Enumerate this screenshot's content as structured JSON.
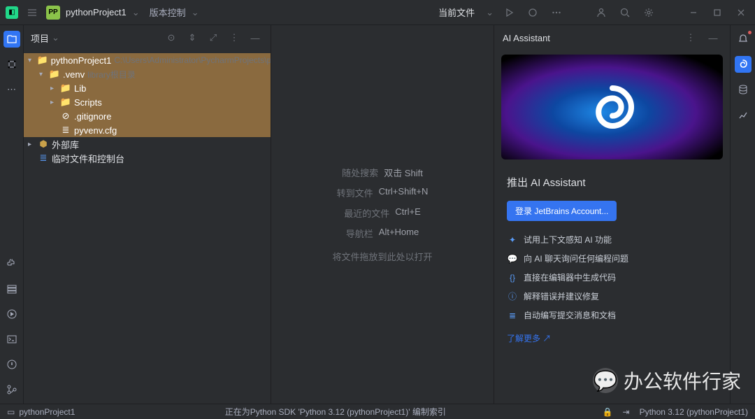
{
  "titlebar": {
    "project_name": "pythonProject1",
    "vcs_label": "版本控制",
    "current_file": "当前文件"
  },
  "project_panel": {
    "title": "项目",
    "tree": {
      "root": {
        "name": "pythonProject1",
        "hint": "C:\\Users\\Administrator\\PycharmProjects\\pytho"
      },
      "venv": {
        "name": ".venv",
        "hint": "library根目录"
      },
      "lib": {
        "name": "Lib"
      },
      "scripts": {
        "name": "Scripts"
      },
      "gitignore": {
        "name": ".gitignore"
      },
      "pyvenv": {
        "name": "pyvenv.cfg"
      },
      "external": {
        "name": "外部库"
      },
      "scratch": {
        "name": "临时文件和控制台"
      }
    }
  },
  "editor": {
    "hints": [
      {
        "label": "随处搜索",
        "key": "双击 Shift"
      },
      {
        "label": "转到文件",
        "key": "Ctrl+Shift+N"
      },
      {
        "label": "最近的文件",
        "key": "Ctrl+E"
      },
      {
        "label": "导航栏",
        "key": "Alt+Home"
      }
    ],
    "drop_hint": "将文件拖放到此处以打开"
  },
  "ai": {
    "panel_title": "AI Assistant",
    "title": "推出 AI Assistant",
    "login_btn": "登录 JetBrains Account...",
    "features": [
      "试用上下文感知 AI 功能",
      "向 AI 聊天询问任何编程问题",
      "直接在编辑器中生成代码",
      "解释错误并建议修复",
      "自动编写提交消息和文档"
    ],
    "learn_more": "了解更多 ↗"
  },
  "statusbar": {
    "left": "pythonProject1",
    "center": "正在为Python SDK 'Python 3.12 (pythonProject1)' 编制索引",
    "interpreter": "Python 3.12 (pythonProject1)"
  },
  "watermark": "办公软件行家"
}
